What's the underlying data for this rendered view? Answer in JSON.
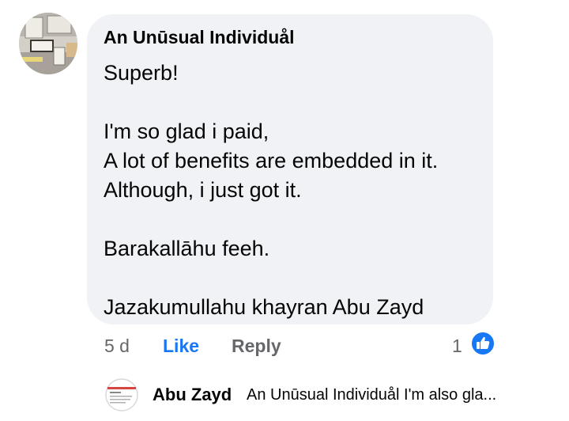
{
  "comment": {
    "avatar_icon": "user-photo-desk",
    "author": "An Unūsual Individuål",
    "lines": [
      "Superb!",
      "",
      "I'm so glad i paid,",
      "A lot of benefits are embedded in it.",
      "Although, i just got it.",
      "",
      "Barakallāhu feeh.",
      "",
      "Jazakumullahu khayran Abu Zayd"
    ]
  },
  "actions": {
    "age": "5 d",
    "like_label": "Like",
    "reply_label": "Reply",
    "reaction_count": "1",
    "reaction_icon": "like-thumbs-up",
    "accent_color": "#1877f2"
  },
  "reply": {
    "avatar_icon": "user-avatar-document",
    "author": "Abu Zayd",
    "snippet": "An Unūsual Individuål I'm also gla..."
  }
}
